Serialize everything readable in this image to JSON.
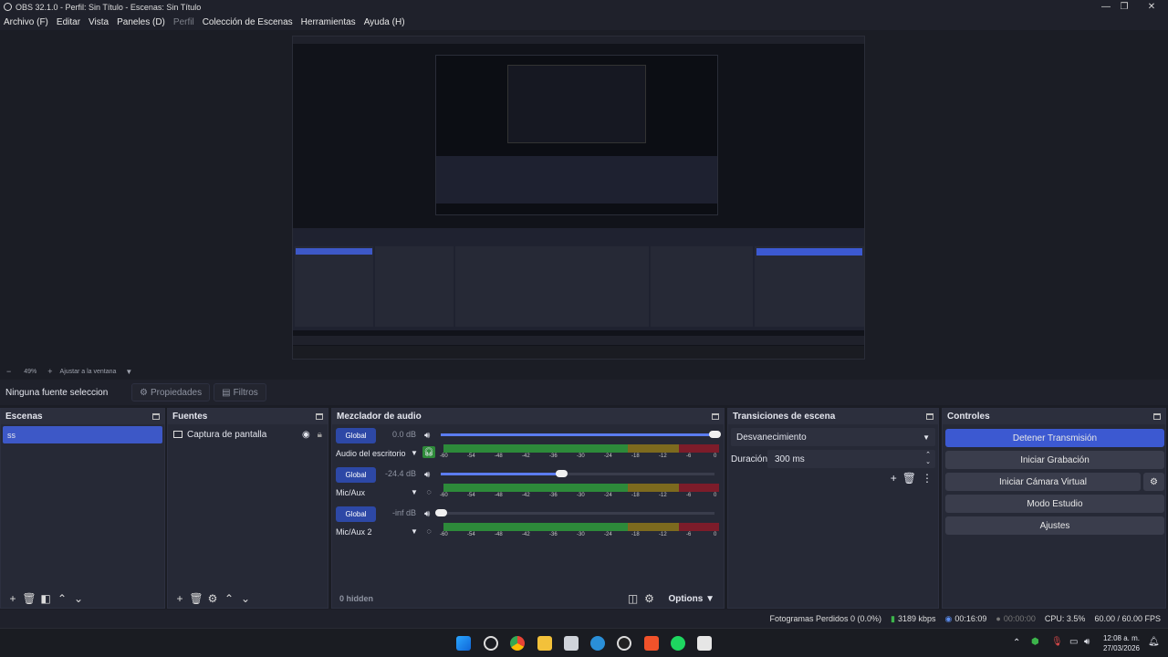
{
  "window": {
    "title": "OBS 32.1.0 - Perfil: Sin Título - Escenas: Sin Título"
  },
  "menu": [
    {
      "label": "Archivo (F)",
      "enabled": true
    },
    {
      "label": "Editar",
      "enabled": true
    },
    {
      "label": "Vista",
      "enabled": true
    },
    {
      "label": "Paneles (D)",
      "enabled": true
    },
    {
      "label": "Perfil",
      "enabled": false
    },
    {
      "label": "Colección de Escenas",
      "enabled": true
    },
    {
      "label": "Herramientas",
      "enabled": true
    },
    {
      "label": "Ayuda (H)",
      "enabled": true
    }
  ],
  "zoom": {
    "percent": "49%",
    "fit_label": "Ajustar a la ventana"
  },
  "context": {
    "source_label": "Ninguna fuente seleccionada",
    "properties": "Propiedades",
    "filters": "Filtros"
  },
  "scenes": {
    "title": "Escenas",
    "items": [
      "ss"
    ]
  },
  "sources": {
    "title": "Fuentes",
    "items": [
      "Captura de pantalla"
    ]
  },
  "mixer": {
    "title": "Mezclador de audio",
    "channels": [
      {
        "name": "Audio del escritorio",
        "db": "0.0 dB",
        "button": "Global",
        "volume": 1.0
      },
      {
        "name": "Mic/Aux",
        "db": "-24.4 dB",
        "button": "Global",
        "volume": 0.44
      },
      {
        "name": "Mic/Aux 2",
        "db": "-inf dB",
        "button": "Global",
        "volume": 0.0
      }
    ],
    "ticks": [
      "-60",
      "-54",
      "-48",
      "-42",
      "-36",
      "-30",
      "-24",
      "-18",
      "-12",
      "-6",
      "0"
    ],
    "hidden": "0 hidden",
    "options": "Options"
  },
  "transitions": {
    "title": "Transiciones de escena",
    "selected": "Desvanecimiento",
    "duration_label": "Duración",
    "duration_value": "300 ms"
  },
  "controls": {
    "title": "Controles",
    "stop_stream": "Detener Transmisión",
    "start_recording": "Iniciar Grabación",
    "start_virtual_cam": "Iniciar Cámara Virtual",
    "studio_mode": "Modo Estudio",
    "settings": "Ajustes"
  },
  "status": {
    "dropped": "Fotogramas Perdidos 0 (0.0%)",
    "bitrate": "3189 kbps",
    "stream_time": "00:16:09",
    "rec_time": "00:00:00",
    "cpu": "CPU: 3.5%",
    "fps": "60.00 / 60.00 FPS"
  },
  "taskbar": {
    "time": "12:08 a. m.",
    "date": "27/03/2026"
  },
  "colors": {
    "accent": "#3c59d1",
    "meter_green": "#2d8a3a",
    "meter_yellow": "#7d6a1e",
    "meter_red": "#7d1c2a"
  }
}
